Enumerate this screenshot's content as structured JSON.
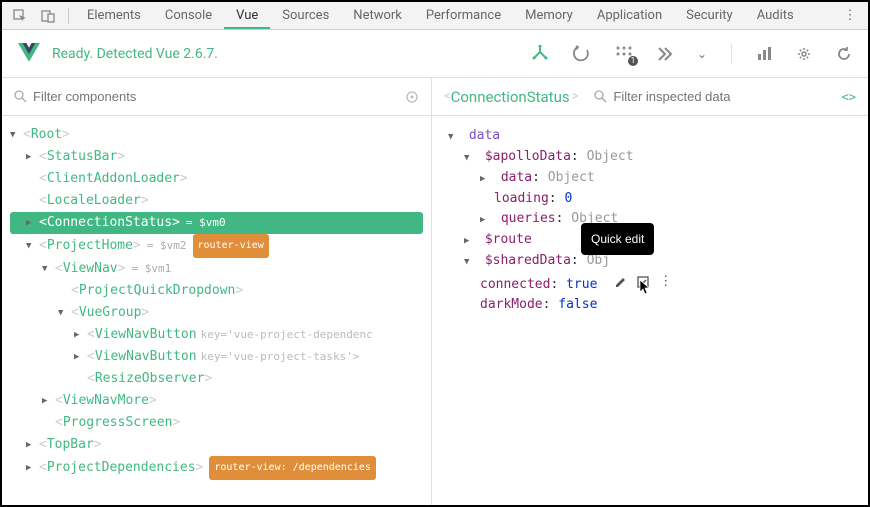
{
  "devtools": {
    "tabs": [
      "Elements",
      "Console",
      "Vue",
      "Sources",
      "Network",
      "Performance",
      "Memory",
      "Application",
      "Security",
      "Audits"
    ],
    "active": "Vue"
  },
  "toolbar": {
    "status": "Ready. Detected Vue 2.6.7."
  },
  "left": {
    "filter_placeholder": "Filter components"
  },
  "tree": [
    {
      "depth": 0,
      "arrow": "down",
      "name": "Root"
    },
    {
      "depth": 1,
      "arrow": "right",
      "name": "StatusBar"
    },
    {
      "depth": 1,
      "arrow": "",
      "name": "ClientAddonLoader"
    },
    {
      "depth": 1,
      "arrow": "",
      "name": "LocaleLoader"
    },
    {
      "depth": 1,
      "arrow": "right",
      "name": "ConnectionStatus",
      "selected": true,
      "extra": " = $vm0"
    },
    {
      "depth": 1,
      "arrow": "down",
      "name": "ProjectHome",
      "extra": " = $vm2",
      "badge": "router-view"
    },
    {
      "depth": 2,
      "arrow": "down",
      "name": "ViewNav",
      "extra": " = $vm1"
    },
    {
      "depth": 3,
      "arrow": "",
      "name": "ProjectQuickDropdown"
    },
    {
      "depth": 3,
      "arrow": "down",
      "name": "VueGroup"
    },
    {
      "depth": 4,
      "arrow": "right",
      "name": "ViewNavButton",
      "attr": "key='vue-project-dependenc"
    },
    {
      "depth": 4,
      "arrow": "right",
      "name": "ViewNavButton",
      "attr": "key='vue-project-tasks'>"
    },
    {
      "depth": 4,
      "arrow": "",
      "name": "ResizeObserver"
    },
    {
      "depth": 2,
      "arrow": "right",
      "name": "ViewNavMore"
    },
    {
      "depth": 2,
      "arrow": "",
      "name": "ProgressScreen"
    },
    {
      "depth": 1,
      "arrow": "right",
      "name": "TopBar"
    },
    {
      "depth": 1,
      "arrow": "right",
      "name": "ProjectDependencies",
      "badge": "router-view: /dependencies"
    }
  ],
  "right": {
    "title": "ConnectionStatus",
    "filter_placeholder": "Filter inspected data"
  },
  "data_tree": {
    "root": "data",
    "apollo_label": "$apolloData",
    "apollo_val": "Object",
    "apollo_data_label": "data",
    "apollo_data_val": "Object",
    "loading_label": "loading",
    "loading_val": "0",
    "queries_label": "queries",
    "queries_val": "Object",
    "route_label": "$route",
    "shared_label": "$sharedData",
    "shared_val": "Object",
    "connected_label": "connected",
    "connected_val": "true",
    "dark_label": "darkMode",
    "dark_val": "false"
  },
  "tooltip": "Quick edit"
}
